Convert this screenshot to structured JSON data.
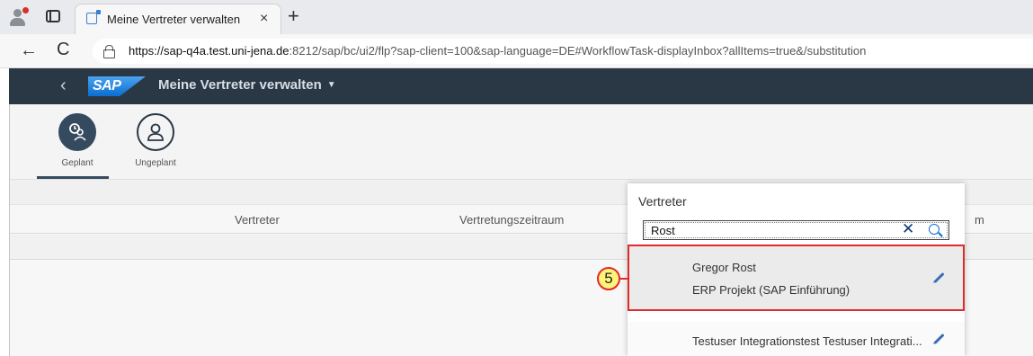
{
  "browser": {
    "tab_title": "Meine Vertreter verwalten",
    "tab_close": "×",
    "new_tab": "+",
    "url_host": "https://sap-q4a.test.uni-jena.de",
    "url_rest": ":8212/sap/bc/ui2/flp?sap-client=100&sap-language=DE#WorkflowTask-displayInbox?allItems=true&/substitution",
    "back": "←",
    "reload": "C"
  },
  "shell": {
    "back": "‹",
    "logo": "SAP",
    "title": "Meine Vertreter verwalten",
    "title_caret": "▼"
  },
  "icon_tabs": [
    {
      "label": "Geplant",
      "icon": "people-calendar-icon",
      "active": true
    },
    {
      "label": "Ungeplant",
      "icon": "person-icon",
      "active": false
    }
  ],
  "table": {
    "columns": [
      "Vertreter",
      "Vertretungszeitraum",
      "m"
    ]
  },
  "popover": {
    "title": "Vertreter",
    "search_value": "Rost",
    "clear_icon": "✕",
    "results": [
      {
        "name": "Gregor Rost",
        "description": "ERP Projekt (SAP Einführung)"
      },
      {
        "name": "Testuser Integrationstest Testuser Integrati..."
      }
    ]
  },
  "annotation": {
    "step": "5",
    "highlight_color": "#e12a2a",
    "badge_color": "#fff47a"
  }
}
